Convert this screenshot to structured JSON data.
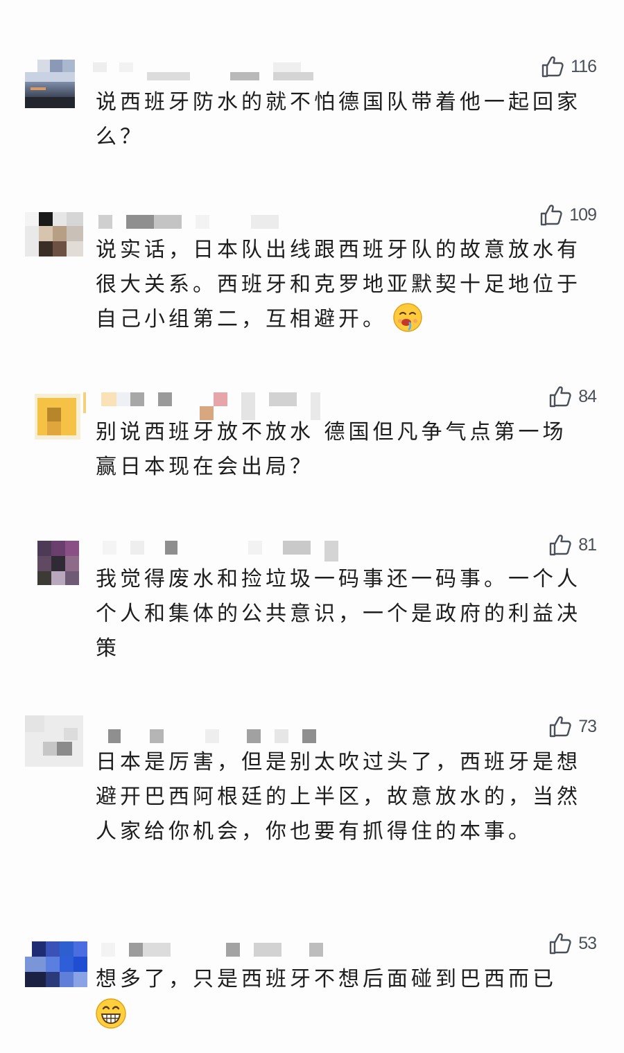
{
  "comments": [
    {
      "likes": "116",
      "text": "说西班牙防水的就不怕德国队带着他一起回家么？"
    },
    {
      "likes": "109",
      "text": "说实话，日本队出线跟西班牙队的故意放水有很大关系。西班牙和克罗地亚默契十足地位于自己小组第二，互相避开。",
      "emoji": "drooling-face"
    },
    {
      "likes": "84",
      "text": "别说西班牙放不放水 德国但凡争气点第一场赢日本现在会出局？"
    },
    {
      "likes": "81",
      "text": "我觉得废水和捡垃圾一码事还一码事。一个人个人和集体的公共意识，一个是政府的利益决策"
    },
    {
      "likes": "73",
      "text": "日本是厉害，但是别太吹过头了，西班牙是想避开巴西阿根廷的上半区，故意放水的，当然人家给你机会，你也要有抓得住的本事。"
    },
    {
      "likes": "53",
      "text": "想多了，只是西班牙不想后面碰到巴西而已",
      "emoji": "grinning-face"
    }
  ],
  "colors": {
    "background": "#fdfdfd",
    "text": "#1d1d1d",
    "like": "#4a4f59"
  },
  "icons": {
    "like": "thumbs-up-icon",
    "avatar": "pixelated-avatar",
    "username": "pixelated-username"
  }
}
